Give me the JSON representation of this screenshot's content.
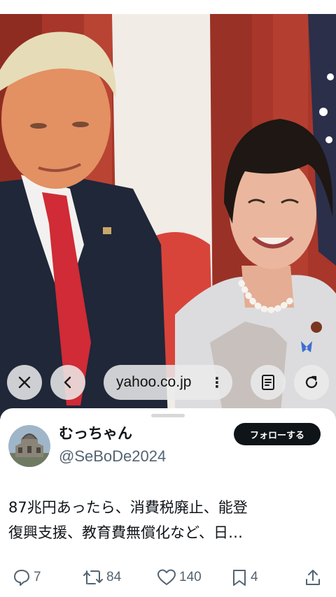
{
  "browser": {
    "url": "yahoo.co.jp",
    "more_glyph": "⋮"
  },
  "post": {
    "display_name": "むっちゃん",
    "handle": "@SeBoDe2024",
    "follow_label": "フォローする",
    "text_lines": [
      "87兆円あったら、消費税廃止、能登",
      "復興支援、教育費無償化など、日…"
    ],
    "stats": {
      "replies": "7",
      "reposts": "84",
      "likes": "140",
      "bookmarks": "4"
    }
  },
  "icons": {
    "close": "close-icon",
    "back": "chevron-left-icon",
    "more": "more-vertical-icon",
    "reader": "reader-mode-icon",
    "reload": "reload-icon",
    "reply": "reply-icon",
    "repost": "repost-icon",
    "like": "heart-icon",
    "bookmark": "bookmark-icon",
    "share": "share-icon"
  },
  "colors": {
    "follow_bg": "#0f1419",
    "secondary_text": "#536471",
    "curtain": "#b83a2b"
  }
}
